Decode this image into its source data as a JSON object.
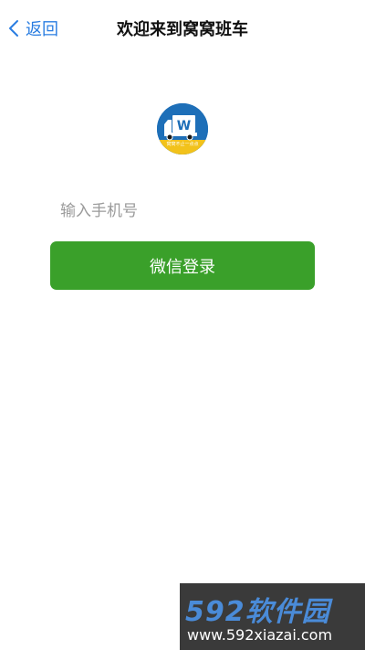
{
  "header": {
    "back_label": "返回",
    "title": "欢迎来到窝窝班车"
  },
  "logo": {
    "icon": "truck-logo-icon",
    "tagline": "窝窝不止一点点",
    "colors": {
      "background": "#1e6fb8",
      "band": "#f2c21b"
    }
  },
  "login": {
    "phone_placeholder": "输入手机号",
    "phone_value": "",
    "wechat_label": "微信登录"
  },
  "watermark": {
    "brand": "592软件园",
    "url": "www.592xiazai.com"
  },
  "colors": {
    "accent": "#2a7de1",
    "button": "#3aa02a"
  }
}
